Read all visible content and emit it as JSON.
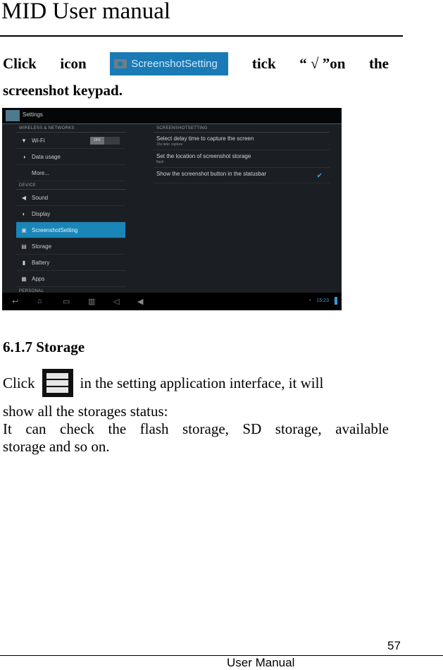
{
  "header": {
    "title": "MID User manual"
  },
  "para1": {
    "click": "Click",
    "icon_word": "icon",
    "button_label": "ScreenshotSetting",
    "tick": "tick",
    "tick_quote": "“ √ ”on",
    "the": "the",
    "line2": "screenshot keypad."
  },
  "screenshot": {
    "app_title": "Settings",
    "sections": {
      "wireless": "WIRELESS & NETWORKS",
      "device": "DEVICE",
      "personal": "PERSONAL",
      "right_header": "SCREENSHOTSETTING"
    },
    "wifi_toggle": "OFF",
    "items": [
      {
        "label": "Wi-Fi",
        "icon": "wifi-icon",
        "glyph": "▼"
      },
      {
        "label": "Data usage",
        "icon": "data-usage-icon",
        "glyph": "◑"
      },
      {
        "label": "More...",
        "icon": "",
        "glyph": ""
      },
      {
        "label": "Sound",
        "icon": "sound-icon",
        "glyph": "◀"
      },
      {
        "label": "Display",
        "icon": "display-icon",
        "glyph": "◐"
      },
      {
        "label": "ScreenshotSetting",
        "icon": "screenshot-icon",
        "glyph": "▣"
      },
      {
        "label": "Storage",
        "icon": "storage-icon",
        "glyph": "▤"
      },
      {
        "label": "Battery",
        "icon": "battery-icon",
        "glyph": "▮"
      },
      {
        "label": "Apps",
        "icon": "apps-icon",
        "glyph": "▦"
      }
    ],
    "right_items": [
      {
        "title": "Select delay time to capture the screen",
        "sub": "15s later capture"
      },
      {
        "title": "Set the location of screenshot storage",
        "sub": "flash"
      },
      {
        "title": "Show the screenshot button in the statusbar",
        "checked": "✔"
      }
    ],
    "clock": "15:23"
  },
  "section": {
    "heading": "6.1.7 Storage",
    "click": "Click",
    "line1_rest": "in the setting application interface, it will",
    "line2": "show all the storages status:",
    "line3": "It can check the flash storage, SD storage, available",
    "line4": "storage and so on."
  },
  "footer": {
    "page_number": "57",
    "label": "User Manual"
  }
}
